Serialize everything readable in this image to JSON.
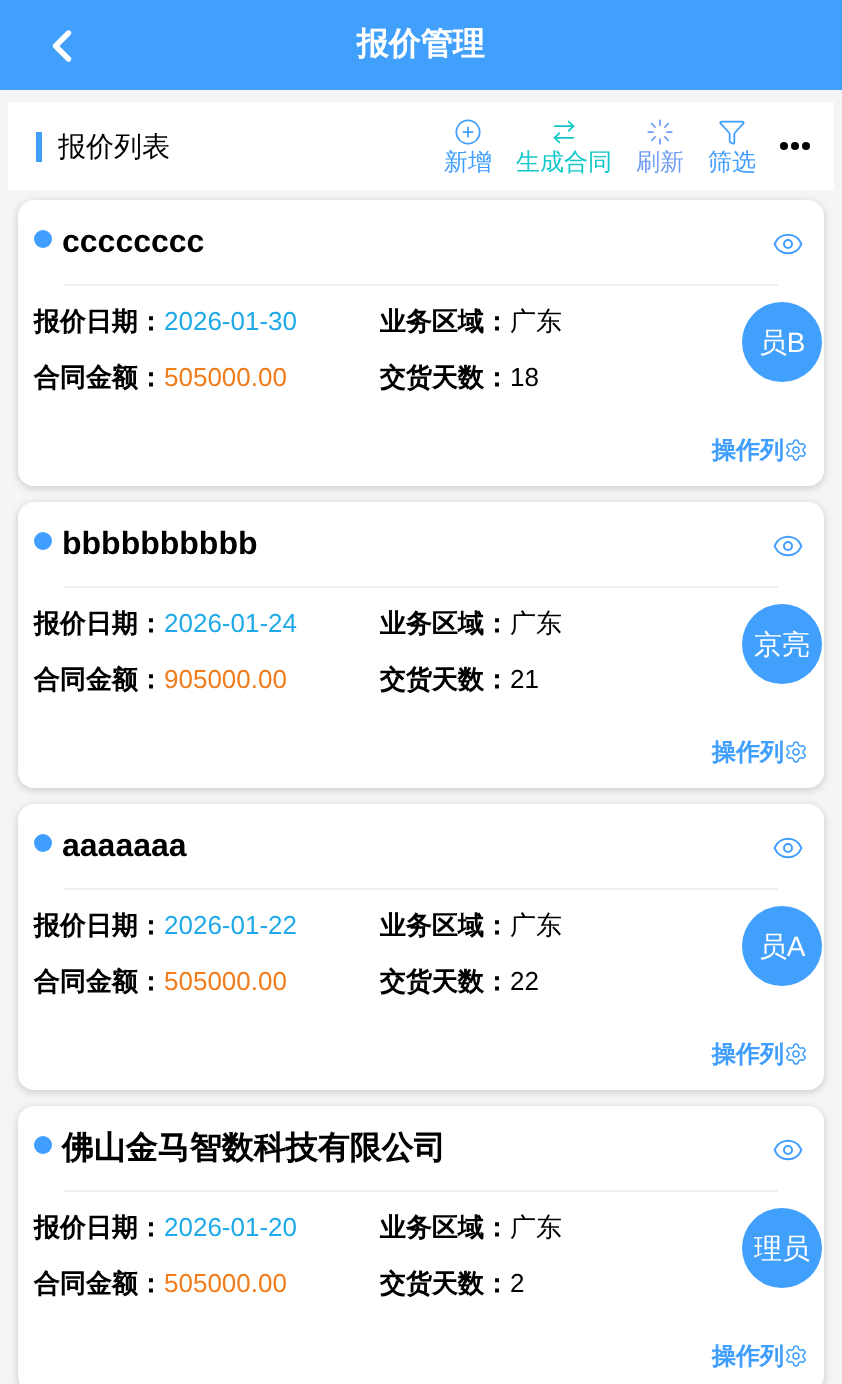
{
  "header": {
    "title": "报价管理"
  },
  "toolbar": {
    "title": "报价列表",
    "actions": [
      {
        "label": "新增",
        "kind": "add",
        "color": "#409eff"
      },
      {
        "label": "生成合同",
        "kind": "convert",
        "color": "#13c8c8"
      },
      {
        "label": "刷新",
        "kind": "refresh",
        "color": "#6f9cf5"
      },
      {
        "label": "筛选",
        "kind": "filter",
        "color": "#409eff"
      }
    ]
  },
  "cards": [
    {
      "title": "cccccccc",
      "date_label": "报价日期：",
      "date": "2026-01-30",
      "region_label": "业务区域：",
      "region": "广东",
      "amount_label": "合同金额：",
      "amount": "505000.00",
      "days_label": "交货天数：",
      "days": "18",
      "avatar": "员B",
      "action": "操作列"
    },
    {
      "title": "bbbbbbbbbb",
      "date_label": "报价日期：",
      "date": "2026-01-24",
      "region_label": "业务区域：",
      "region": "广东",
      "amount_label": "合同金额：",
      "amount": "905000.00",
      "days_label": "交货天数：",
      "days": "21",
      "avatar": "京亮",
      "action": "操作列"
    },
    {
      "title": "aaaaaaa",
      "date_label": "报价日期：",
      "date": "2026-01-22",
      "region_label": "业务区域：",
      "region": "广东",
      "amount_label": "合同金额：",
      "amount": "505000.00",
      "days_label": "交货天数：",
      "days": "22",
      "avatar": "员A",
      "action": "操作列"
    },
    {
      "title": "佛山金马智数科技有限公司",
      "date_label": "报价日期：",
      "date": "2026-01-20",
      "region_label": "业务区域：",
      "region": "广东",
      "amount_label": "合同金额：",
      "amount": "505000.00",
      "days_label": "交货天数：",
      "days": "2",
      "avatar": "理员",
      "action": "操作列"
    }
  ]
}
